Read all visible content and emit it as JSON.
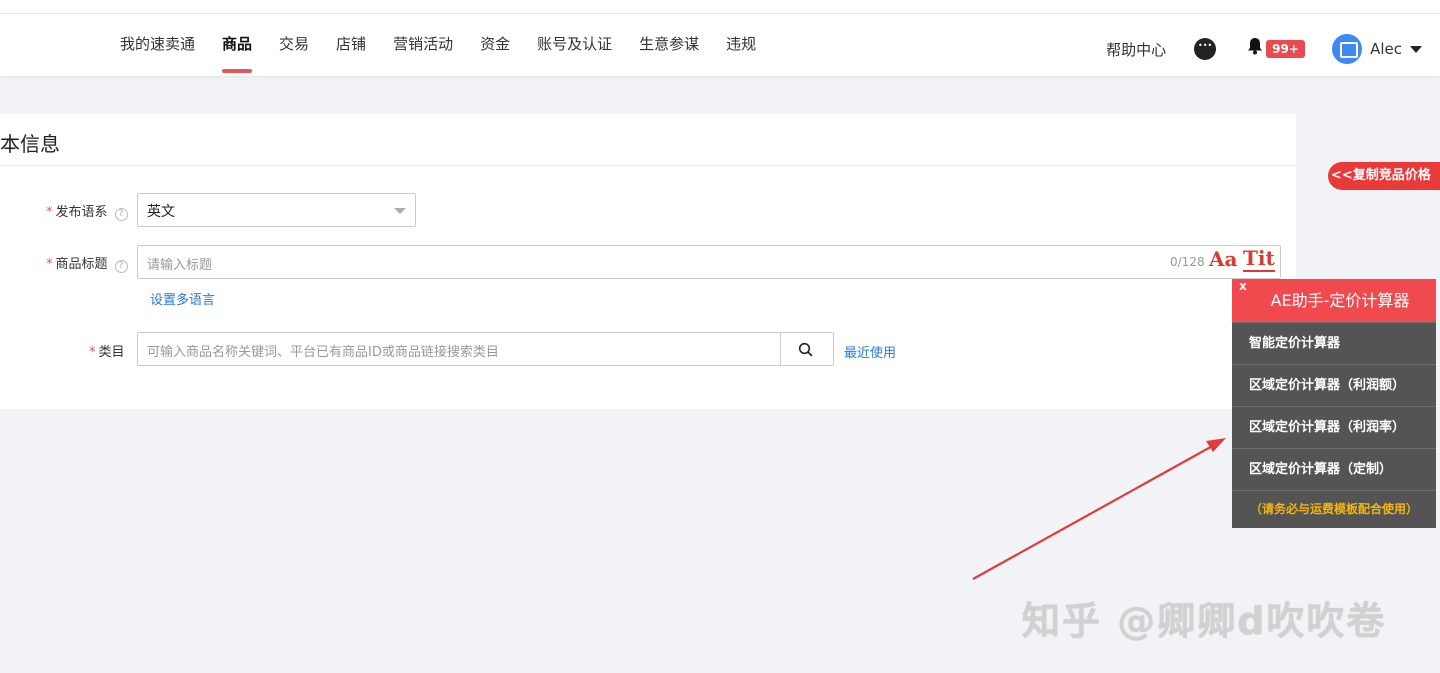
{
  "nav": {
    "items": [
      {
        "label": "我的速卖通"
      },
      {
        "label": "商品"
      },
      {
        "label": "交易"
      },
      {
        "label": "店铺"
      },
      {
        "label": "营销活动"
      },
      {
        "label": "资金"
      },
      {
        "label": "账号及认证"
      },
      {
        "label": "生意参谋"
      },
      {
        "label": "违规"
      }
    ],
    "active_index": 1,
    "help": "帮助中心",
    "badge": "99+",
    "user": "Alec"
  },
  "card": {
    "title": "本信息",
    "language_label": "发布语系",
    "language_value": "英文",
    "title_label": "商品标题",
    "title_placeholder": "请输入标题",
    "title_count": "0/128",
    "aa_label": "Aa",
    "tit_label": "Tit",
    "multi_lang_link": "设置多语言",
    "category_label": "类目",
    "category_placeholder": "可输入商品名称关键词、平台已有商品ID或商品链接搜索类目",
    "recent_link": "最近使用",
    "required_mark": "*",
    "help_mark": "?"
  },
  "widget": {
    "copy_price": "<<复制竞品价格",
    "close": "x",
    "title": "AE助手-定价计算器",
    "items": [
      {
        "label": "智能定价计算器"
      },
      {
        "label": "区域定价计算器（利润额）"
      },
      {
        "label": "区域定价计算器（利润率）"
      },
      {
        "label": "区域定价计算器（定制）"
      }
    ],
    "note": "（请务必与运费模板配合使用）"
  },
  "watermark": "知乎 @卿卿d吹吹卷",
  "colors": {
    "accent": "#e8545a",
    "link": "#2a7ad6",
    "panel_head": "#f04a4e",
    "panel_body": "#545454",
    "note": "#f5b50a",
    "arrow": "#e23b3b"
  }
}
